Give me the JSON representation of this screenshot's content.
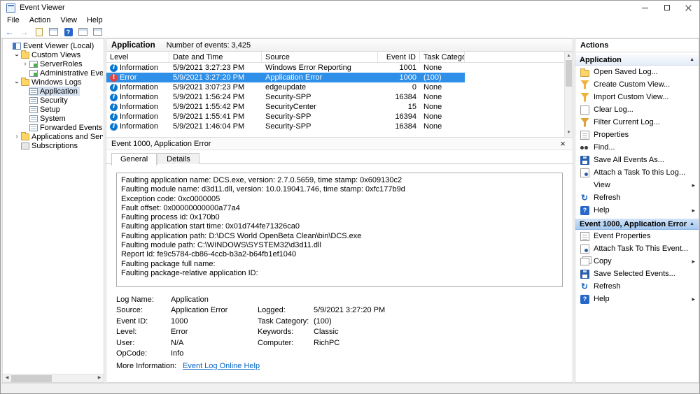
{
  "colors": {
    "selection": "#2e8fe8",
    "tree-selection": "#d3e0ef",
    "link": "#0563c1",
    "info-icon": "#0b77d0",
    "error-icon": "#e04343"
  },
  "window": {
    "title": "Event Viewer",
    "menu": [
      "File",
      "Action",
      "View",
      "Help"
    ]
  },
  "toolbar": {
    "icons": [
      {
        "name": "back-icon",
        "cls": "tb-back",
        "glyph": "←"
      },
      {
        "name": "forward-icon",
        "cls": "tb-fwd",
        "glyph": "→"
      },
      {
        "name": "export-list-icon",
        "cls": "tb-doc",
        "glyph": ""
      },
      {
        "name": "console-tree-icon",
        "cls": "tb-win",
        "glyph": ""
      },
      {
        "name": "help-icon",
        "cls": "tb-help",
        "glyph": "?"
      },
      {
        "name": "show-action-pane-icon",
        "cls": "tb-win",
        "glyph": ""
      },
      {
        "name": "preview-pane-icon",
        "cls": "tb-win",
        "glyph": ""
      }
    ]
  },
  "tree": {
    "items": [
      {
        "label": "Event Viewer (Local)",
        "level": 0,
        "exp": "none",
        "icon": "ev",
        "state": "",
        "name": "tree-item-event-viewer-local"
      },
      {
        "label": "Custom Views",
        "level": 1,
        "exp": "open",
        "icon": "folder",
        "state": "",
        "name": "tree-item-custom-views"
      },
      {
        "label": "ServerRoles",
        "level": 2,
        "exp": "closed",
        "icon": "custview",
        "state": "",
        "name": "tree-item-serverroles"
      },
      {
        "label": "Administrative Events",
        "level": 2,
        "exp": "none",
        "icon": "custview",
        "state": "",
        "name": "tree-item-administrative-events"
      },
      {
        "label": "Windows Logs",
        "level": 1,
        "exp": "open",
        "icon": "folder",
        "state": "",
        "name": "tree-item-windows-logs"
      },
      {
        "label": "Application",
        "level": 2,
        "exp": "none",
        "icon": "log",
        "state": "selected",
        "name": "tree-item-application"
      },
      {
        "label": "Security",
        "level": 2,
        "exp": "none",
        "icon": "log",
        "state": "",
        "name": "tree-item-security"
      },
      {
        "label": "Setup",
        "level": 2,
        "exp": "none",
        "icon": "log",
        "state": "",
        "name": "tree-item-setup"
      },
      {
        "label": "System",
        "level": 2,
        "exp": "none",
        "icon": "log",
        "state": "",
        "name": "tree-item-system"
      },
      {
        "label": "Forwarded Events",
        "level": 2,
        "exp": "none",
        "icon": "log",
        "state": "",
        "name": "tree-item-forwarded-events"
      },
      {
        "label": "Applications and Services Lo",
        "level": 1,
        "exp": "closed",
        "icon": "folder",
        "state": "",
        "name": "tree-item-applications-and-services-logs"
      },
      {
        "label": "Subscriptions",
        "level": 1,
        "exp": "none",
        "icon": "subs",
        "state": "",
        "name": "tree-item-subscriptions"
      }
    ]
  },
  "main": {
    "title": "Application",
    "count_text": "Number of events: 3,425",
    "table": {
      "columns": [
        {
          "label": "Level",
          "key": "level"
        },
        {
          "label": "Date and Time",
          "key": "date"
        },
        {
          "label": "Source",
          "key": "source"
        },
        {
          "label": "Event ID",
          "key": "id"
        },
        {
          "label": "Task Category",
          "key": "task"
        }
      ],
      "rows": [
        {
          "level": "Information",
          "icon": "info",
          "datetime": "5/9/2021 3:27:23 PM",
          "source": "Windows Error Reporting",
          "event_id": "1001",
          "task": "None",
          "state": ""
        },
        {
          "level": "Error",
          "icon": "error",
          "datetime": "5/9/2021 3:27:20 PM",
          "source": "Application Error",
          "event_id": "1000",
          "task": "(100)",
          "state": "selected"
        },
        {
          "level": "Information",
          "icon": "info",
          "datetime": "5/9/2021 3:07:23 PM",
          "source": "edgeupdate",
          "event_id": "0",
          "task": "None",
          "state": ""
        },
        {
          "level": "Information",
          "icon": "info",
          "datetime": "5/9/2021 1:56:24 PM",
          "source": "Security-SPP",
          "event_id": "16384",
          "task": "None",
          "state": ""
        },
        {
          "level": "Information",
          "icon": "info",
          "datetime": "5/9/2021 1:55:42 PM",
          "source": "SecurityCenter",
          "event_id": "15",
          "task": "None",
          "state": ""
        },
        {
          "level": "Information",
          "icon": "info",
          "datetime": "5/9/2021 1:55:41 PM",
          "source": "Security-SPP",
          "event_id": "16394",
          "task": "None",
          "state": ""
        },
        {
          "level": "Information",
          "icon": "info",
          "datetime": "5/9/2021 1:46:04 PM",
          "source": "Security-SPP",
          "event_id": "16384",
          "task": "None",
          "state": ""
        }
      ]
    }
  },
  "detail": {
    "title": "Event 1000, Application Error",
    "tabs": [
      {
        "label": "General",
        "state": "active"
      },
      {
        "label": "Details",
        "state": ""
      }
    ],
    "general_lines": [
      "Faulting application name: DCS.exe, version: 2.7.0.5659, time stamp: 0x609130c2",
      "Faulting module name: d3d11.dll, version: 10.0.19041.746, time stamp: 0xfc177b9d",
      "Exception code: 0xc0000005",
      "Fault offset: 0x00000000000a77a4",
      "Faulting process id: 0x170b0",
      "Faulting application start time: 0x01d744fe71326ca0",
      "Faulting application path: D:\\DCS World OpenBeta Clean\\bin\\DCS.exe",
      "Faulting module path: C:\\WINDOWS\\SYSTEM32\\d3d11.dll",
      "Report Id: fe9c5784-cb86-4ccb-b3a2-b64fb1ef1040",
      "Faulting package full name:",
      "Faulting package-relative application ID:"
    ],
    "fields": [
      {
        "l1": "Log Name:",
        "v1": "Application",
        "l2": "",
        "v2": ""
      },
      {
        "l1": "Source:",
        "v1": "Application Error",
        "l2": "Logged:",
        "v2": "5/9/2021 3:27:20 PM"
      },
      {
        "l1": "Event ID:",
        "v1": "1000",
        "l2": "Task Category:",
        "v2": "(100)"
      },
      {
        "l1": "Level:",
        "v1": "Error",
        "l2": "Keywords:",
        "v2": "Classic"
      },
      {
        "l1": "User:",
        "v1": "N/A",
        "l2": "Computer:",
        "v2": "RichPC"
      },
      {
        "l1": "OpCode:",
        "v1": "Info",
        "l2": "",
        "v2": ""
      }
    ],
    "more_info_label": "More Information:",
    "more_info_link": "Event Log Online Help"
  },
  "actions": {
    "title": "Actions",
    "sections": [
      {
        "header": "Application",
        "items": [
          {
            "label": "Open Saved Log...",
            "icon": "ic-openlog",
            "name": "action-open-saved-log",
            "submenu": false
          },
          {
            "label": "Create Custom View...",
            "icon": "ic-custview",
            "name": "action-create-custom-view",
            "submenu": false
          },
          {
            "label": "Import Custom View...",
            "icon": "ic-import",
            "name": "action-import-custom-view",
            "submenu": false
          },
          {
            "label": "Clear Log...",
            "icon": "ic-clear",
            "name": "action-clear-log",
            "submenu": false
          },
          {
            "label": "Filter Current Log...",
            "icon": "ic-filter",
            "name": "action-filter-current-log",
            "submenu": false
          },
          {
            "label": "Properties",
            "icon": "ic-props",
            "name": "action-properties",
            "submenu": false
          },
          {
            "label": "Find...",
            "icon": "ic-find",
            "name": "action-find",
            "submenu": false
          },
          {
            "label": "Save All Events As...",
            "icon": "ic-save",
            "name": "action-save-all-events-as",
            "submenu": false
          },
          {
            "label": "Attach a Task To this Log...",
            "icon": "ic-task",
            "name": "action-attach-task-to-log",
            "submenu": false
          },
          {
            "label": "View",
            "icon": "ic-none",
            "name": "action-view",
            "submenu": true
          },
          {
            "label": "Refresh",
            "icon": "ic-refresh",
            "name": "action-refresh",
            "submenu": false
          },
          {
            "label": "Help",
            "icon": "ic-help",
            "name": "action-help",
            "submenu": true
          }
        ]
      },
      {
        "header": "Event 1000, Application Error",
        "items": [
          {
            "label": "Event Properties",
            "icon": "ic-props",
            "name": "action-event-properties",
            "submenu": false
          },
          {
            "label": "Attach Task To This Event...",
            "icon": "ic-task",
            "name": "action-attach-task-to-event",
            "submenu": false
          },
          {
            "label": "Copy",
            "icon": "ic-copy",
            "name": "action-copy",
            "submenu": true
          },
          {
            "label": "Save Selected Events...",
            "icon": "ic-save",
            "name": "action-save-selected-events",
            "submenu": false
          },
          {
            "label": "Refresh",
            "icon": "ic-refresh",
            "name": "action-refresh-2",
            "submenu": false
          },
          {
            "label": "Help",
            "icon": "ic-help",
            "name": "action-help-2",
            "submenu": true
          }
        ]
      }
    ]
  }
}
